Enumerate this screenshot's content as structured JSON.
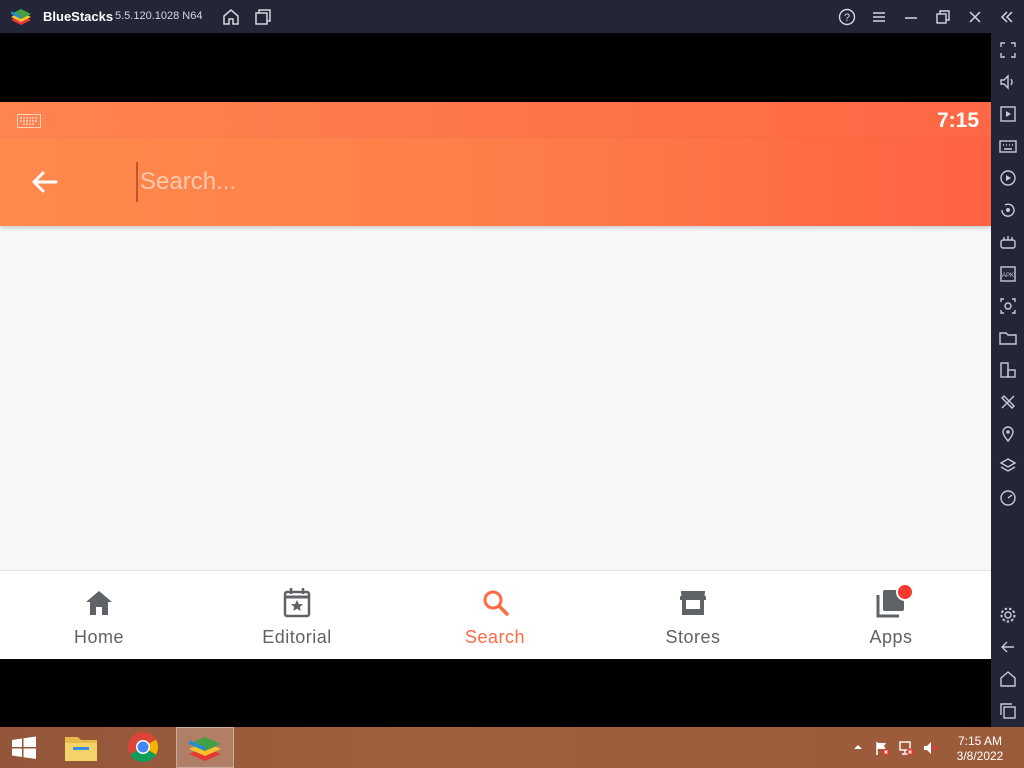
{
  "window": {
    "app_name": "BlueStacks",
    "version": "5.5.120.1028",
    "arch": "N64"
  },
  "android": {
    "status_time": "7:15",
    "search": {
      "placeholder": "Search..."
    },
    "nav": [
      {
        "label": "Home",
        "icon": "home-icon"
      },
      {
        "label": "Editorial",
        "icon": "calendar-star-icon"
      },
      {
        "label": "Search",
        "icon": "search-icon",
        "active": true
      },
      {
        "label": "Stores",
        "icon": "store-icon"
      },
      {
        "label": "Apps",
        "icon": "apps-library-icon",
        "badge": true
      }
    ],
    "accent_color": "#ff6a45"
  },
  "sidebar": {
    "icons": [
      "fullscreen-icon",
      "volume-icon",
      "media-icon",
      "keyboard-icon",
      "macro-play-icon",
      "rotate-icon",
      "gamepad-icon",
      "apk-icon",
      "screenshot-icon",
      "folder-icon",
      "multi-instance-icon",
      "eco-mode-icon",
      "location-icon",
      "layers-icon",
      "speed-icon",
      "settings-icon",
      "back-icon",
      "home-icon",
      "recents-icon"
    ]
  },
  "taskbar": {
    "time": "7:15 AM",
    "date": "3/8/2022"
  }
}
